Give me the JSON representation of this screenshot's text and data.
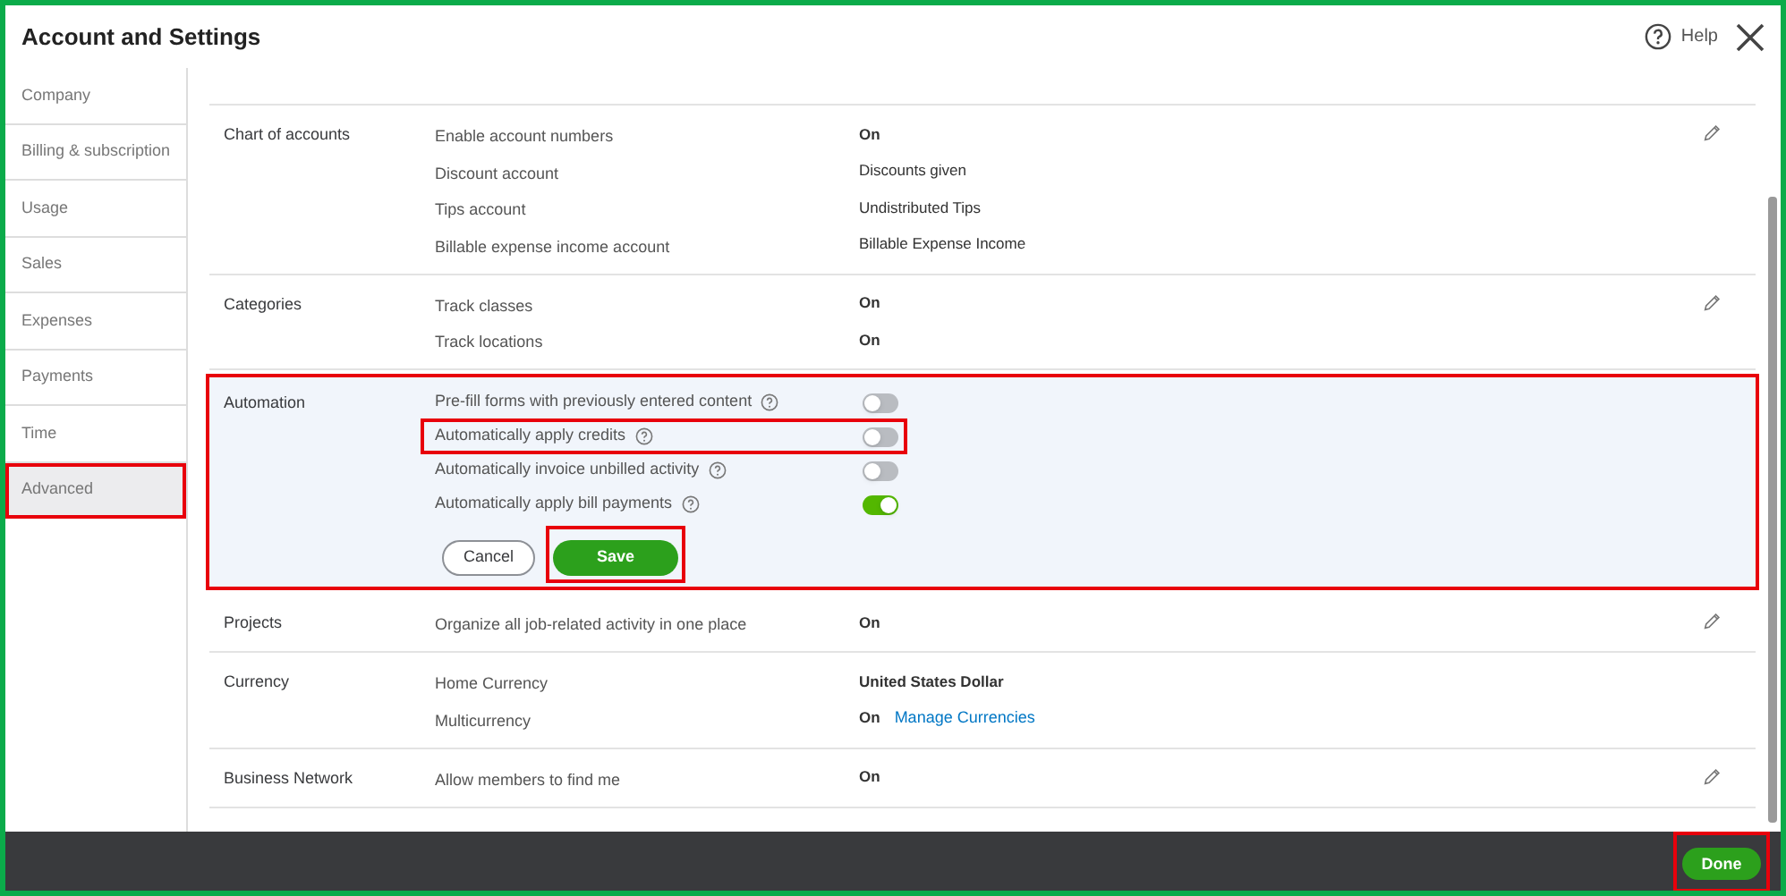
{
  "window": {
    "title": "Account and Settings"
  },
  "help": {
    "label": "Help"
  },
  "sidebar": {
    "items": [
      {
        "label": "Company",
        "selected": false,
        "highlighted": false
      },
      {
        "label": "Billing & subscription",
        "selected": false,
        "highlighted": false
      },
      {
        "label": "Usage",
        "selected": false,
        "highlighted": false
      },
      {
        "label": "Sales",
        "selected": false,
        "highlighted": false
      },
      {
        "label": "Expenses",
        "selected": false,
        "highlighted": false
      },
      {
        "label": "Payments",
        "selected": false,
        "highlighted": false
      },
      {
        "label": "Time",
        "selected": false,
        "highlighted": false
      },
      {
        "label": "Advanced",
        "selected": true,
        "highlighted": true
      }
    ]
  },
  "sections": [
    {
      "title": "Chart of accounts",
      "editable": true,
      "editing": false,
      "highlighted": false,
      "rows": [
        {
          "kind": "text",
          "label": "Enable account numbers",
          "value": "On",
          "bold": true
        },
        {
          "kind": "text",
          "label": "Discount account",
          "value": "Discounts given",
          "bold": false
        },
        {
          "kind": "text",
          "label": "Tips account",
          "value": "Undistributed Tips",
          "bold": false
        },
        {
          "kind": "text",
          "label": "Billable expense income account",
          "value": "Billable Expense Income",
          "bold": false
        }
      ]
    },
    {
      "title": "Categories",
      "editable": true,
      "editing": false,
      "highlighted": false,
      "rows": [
        {
          "kind": "text",
          "label": "Track classes",
          "value": "On",
          "bold": true
        },
        {
          "kind": "text",
          "label": "Track locations",
          "value": "On",
          "bold": true
        }
      ]
    },
    {
      "title": "Automation",
      "editable": false,
      "editing": true,
      "highlighted": true,
      "rows": [
        {
          "kind": "toggle",
          "label": "Pre-fill forms with previously entered content",
          "on": false,
          "highlighted": false
        },
        {
          "kind": "toggle",
          "label": "Automatically apply credits",
          "on": false,
          "highlighted": true
        },
        {
          "kind": "toggle",
          "label": "Automatically invoice unbilled activity",
          "on": false,
          "highlighted": false
        },
        {
          "kind": "toggle",
          "label": "Automatically apply bill payments",
          "on": true,
          "highlighted": false
        }
      ],
      "actions": [
        {
          "kind": "cancel",
          "label": "Cancel",
          "highlighted": false
        },
        {
          "kind": "save",
          "label": "Save",
          "highlighted": true
        }
      ]
    },
    {
      "title": "Projects",
      "editable": true,
      "editing": false,
      "highlighted": false,
      "rows": [
        {
          "kind": "text",
          "label": "Organize all job-related activity in one place",
          "value": "On",
          "bold": true
        }
      ]
    },
    {
      "title": "Currency",
      "editable": false,
      "editing": false,
      "highlighted": false,
      "rows": [
        {
          "kind": "text",
          "label": "Home Currency",
          "value": "United States Dollar",
          "bold": true
        },
        {
          "kind": "text",
          "label": "Multicurrency",
          "value": "On",
          "bold": true,
          "link": "Manage Currencies"
        }
      ]
    },
    {
      "title": "Business Network",
      "editable": true,
      "editing": false,
      "highlighted": false,
      "rows": [
        {
          "kind": "text",
          "label": "Allow members to find me",
          "value": "On",
          "bold": true
        }
      ]
    }
  ],
  "footer": {
    "done": {
      "label": "Done",
      "highlighted": true
    }
  }
}
